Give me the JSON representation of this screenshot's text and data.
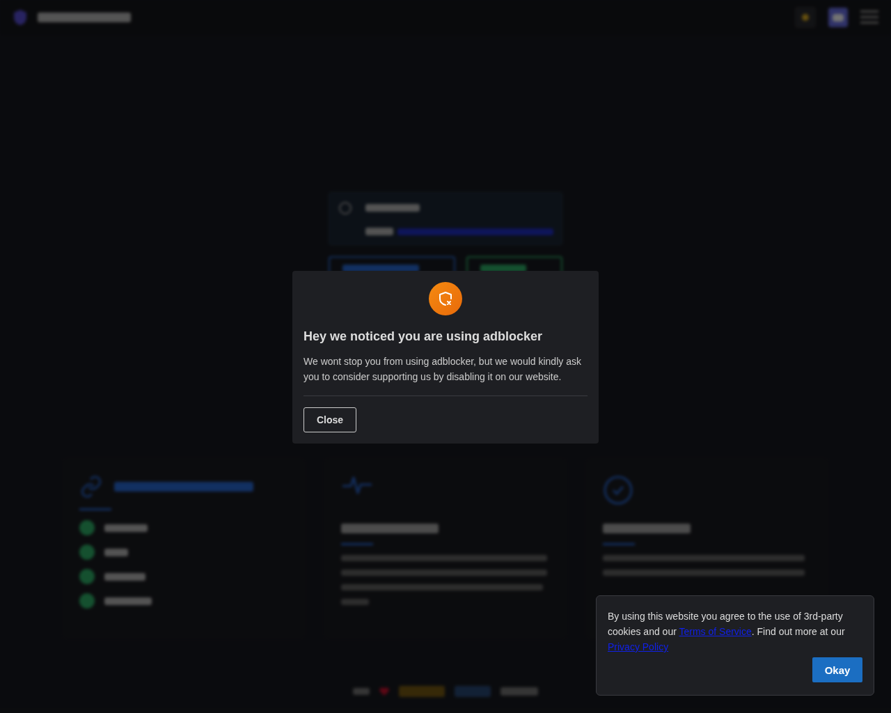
{
  "backdrop": {
    "cards": [
      {
        "kind": "list"
      },
      {
        "kind": "pulse"
      },
      {
        "kind": "check"
      }
    ]
  },
  "modal": {
    "title": "Hey we noticed you are using adblocker",
    "body": "We wont stop you from using adblocker, but we would kindly ask you to consider supporting us by disabling it on our website.",
    "button": "Close"
  },
  "cookie": {
    "before": "By using this website you agree to the use of 3rd-party cookies and our ",
    "terms": "Terms of Service",
    "middle": ". Find out more at our ",
    "privacy": "Privacy Policy",
    "button": "Okay"
  }
}
